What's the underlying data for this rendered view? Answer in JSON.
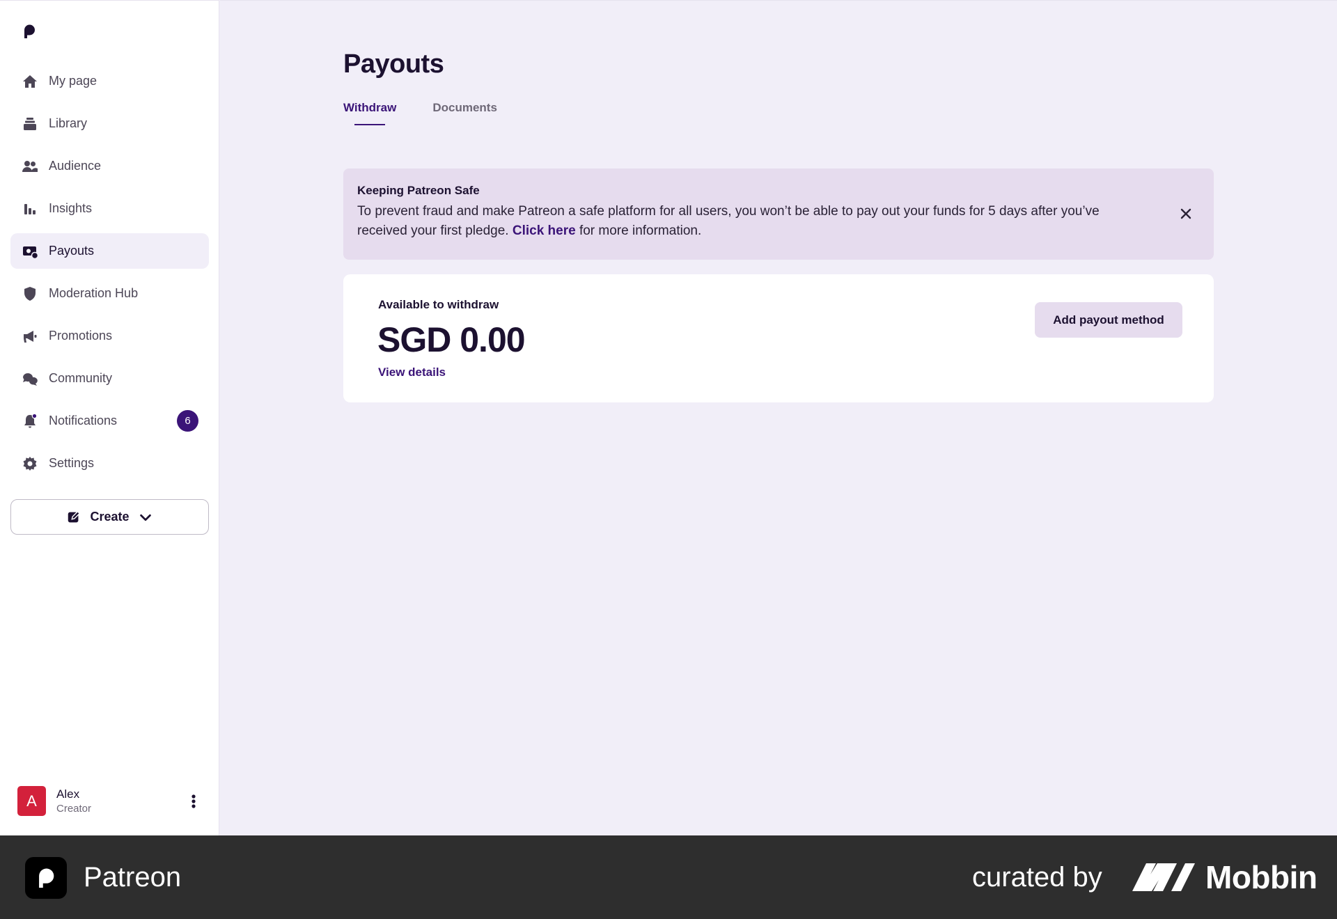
{
  "sidebar": {
    "logo": "patreon-logo",
    "items": [
      {
        "label": "My page",
        "icon": "home-icon"
      },
      {
        "label": "Library",
        "icon": "library-icon"
      },
      {
        "label": "Audience",
        "icon": "audience-icon"
      },
      {
        "label": "Insights",
        "icon": "insights-icon"
      },
      {
        "label": "Payouts",
        "icon": "payouts-icon",
        "active": true
      },
      {
        "label": "Moderation Hub",
        "icon": "shield-icon"
      },
      {
        "label": "Promotions",
        "icon": "megaphone-icon"
      },
      {
        "label": "Community",
        "icon": "chat-icon"
      },
      {
        "label": "Notifications",
        "icon": "bell-icon",
        "badge": "6"
      },
      {
        "label": "Settings",
        "icon": "gear-icon"
      }
    ],
    "create_label": "Create",
    "user": {
      "initial": "A",
      "name": "Alex",
      "role": "Creator"
    }
  },
  "main": {
    "title": "Payouts",
    "tabs": [
      {
        "label": "Withdraw",
        "active": true
      },
      {
        "label": "Documents",
        "active": false
      }
    ],
    "alert": {
      "title": "Keeping Patreon Safe",
      "body_before": "To prevent fraud and make Patreon a safe platform for all users, you won’t be able to pay out your funds for 5 days after you’ve received your first pledge. ",
      "link": "Click here",
      "body_after": " for more information."
    },
    "balance": {
      "label": "Available to withdraw",
      "amount": "SGD 0.00",
      "details_link": "View details",
      "action_label": "Add payout method"
    }
  },
  "footer": {
    "app_name": "Patreon",
    "curated_by": "curated by",
    "brand": "Mobbin"
  },
  "colors": {
    "accent": "#3b1478",
    "background": "#f1eef8",
    "alert_bg": "#e6dcee",
    "avatar_bg": "#d3213b",
    "footer_bg": "#2e2e2e"
  }
}
